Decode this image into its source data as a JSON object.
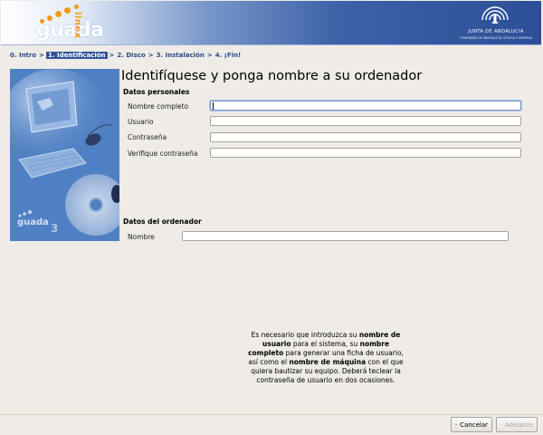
{
  "header": {
    "logo_text": "guada",
    "logo_suffix": "linex",
    "org_name": "JUNTA DE ANDALUCIA",
    "org_sub": "CONSEJERÍA DE INNOVACIÓN, CIENCIA Y EMPRESA"
  },
  "steps": [
    {
      "label": "0. Intro",
      "active": false
    },
    {
      "label": "1. Identificación",
      "active": true
    },
    {
      "label": "2. Disco",
      "active": false
    },
    {
      "label": "3. Instalación",
      "active": false
    },
    {
      "label": "4. ¡Fin!",
      "active": false
    }
  ],
  "side_image": {
    "brand": "guada",
    "version": "3"
  },
  "page": {
    "title": "Identifíquese y ponga nombre a su ordenador",
    "personal_section": "Datos personales",
    "computer_section": "Datos del ordenador"
  },
  "fields": {
    "full_name": {
      "label": "Nombre completo",
      "value": ""
    },
    "username": {
      "label": "Usuario",
      "value": ""
    },
    "password": {
      "label": "Contraseña",
      "value": ""
    },
    "password_confirm": {
      "label": "Verifique contraseña",
      "value": ""
    },
    "hostname": {
      "label": "Nombre",
      "value": ""
    }
  },
  "help": {
    "p1": "Es necesario que introduzca su ",
    "b1": "nombre de usuario",
    "p2": " para el sistema, su ",
    "b2": "nombre completo",
    "p3": " para generar una ficha de usuario, así como el ",
    "b3": "nombre de máquina",
    "p4": " con el que quiera bautizar su equipo. Deberá teclear la contraseña de usuario en dos ocasiones."
  },
  "buttons": {
    "cancel": "Cancelar",
    "forward": "Adelante"
  },
  "colors": {
    "accent": "#2f5496",
    "logo_orange": "#f39a1b",
    "background": "#efebe7"
  },
  "icons": {
    "cancel": "red-x-icon",
    "forward": "forward-arrow-icon"
  }
}
